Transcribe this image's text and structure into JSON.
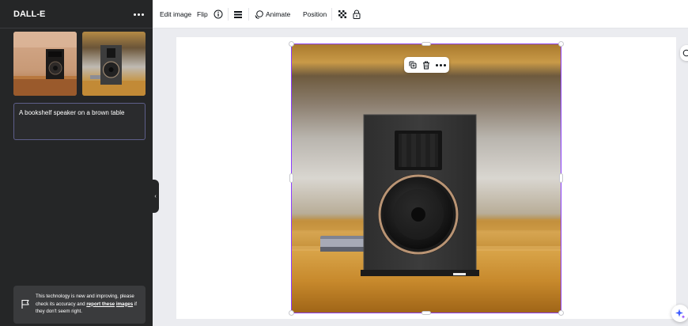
{
  "panel": {
    "title": "DALL-E",
    "prompt_text": "A bookshelf speaker on a brown table",
    "notice": {
      "text_before": "This technology is new and improving, please check its accuracy and ",
      "link_text_a": "report these",
      "link_text_b": "images",
      "text_after": " if they don't seem right."
    },
    "collapse_glyph": "‹"
  },
  "toolbar": {
    "edit_image_label": "Edit image",
    "flip_label": "Flip",
    "animate_label": "Animate",
    "position_label": "Position"
  },
  "icons": {
    "more": "more-horizontal-icon",
    "info": "info-icon",
    "lines": "line-weight-icon",
    "animate": "animate-icon",
    "transparency": "transparency-icon",
    "lock": "lock-icon",
    "copy": "duplicate-icon",
    "delete": "trash-icon",
    "flag": "flag-icon",
    "magic": "magic-sparkle-icon",
    "right_tab": "comment-icon"
  },
  "colors": {
    "panel_bg": "#252627",
    "selection": "#8b3dff",
    "canvas_bg": "#ebecf0"
  }
}
